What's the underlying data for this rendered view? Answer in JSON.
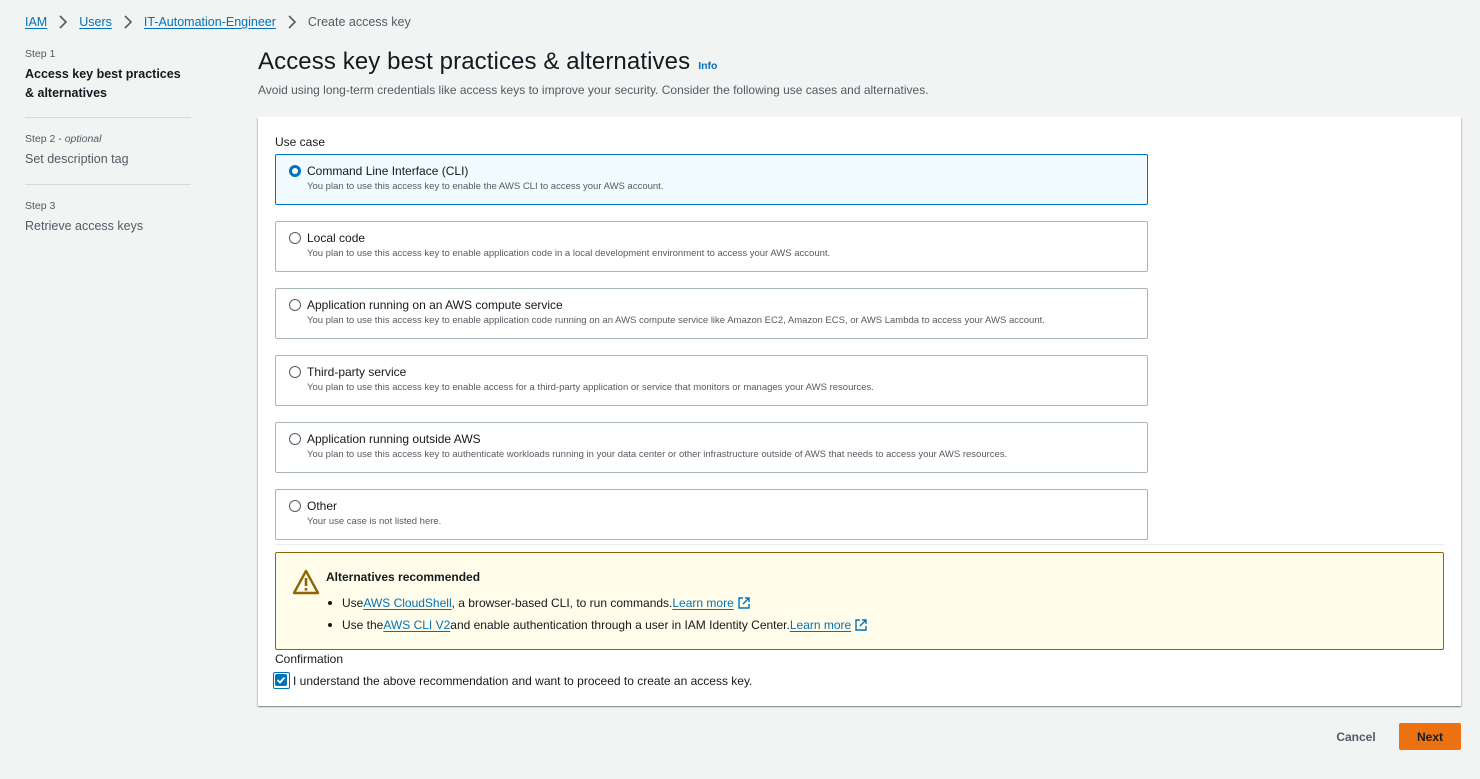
{
  "breadcrumb": {
    "items": [
      "IAM",
      "Users",
      "IT-Automation-Engineer"
    ],
    "current": "Create access key"
  },
  "steps": [
    {
      "num": "Step 1",
      "optional": "",
      "title": "Access key best practices & alternatives"
    },
    {
      "num": "Step 2 - ",
      "optional": "optional",
      "title": "Set description tag"
    },
    {
      "num": "Step 3",
      "optional": "",
      "title": "Retrieve access keys"
    }
  ],
  "header": {
    "title": "Access key best practices & alternatives",
    "info": "Info",
    "subtitle": "Avoid using long-term credentials like access keys to improve your security. Consider the following use cases and alternatives."
  },
  "use_case": {
    "label": "Use case",
    "selected": "Command Line Interface (CLI)",
    "options": [
      {
        "title": "Command Line Interface (CLI)",
        "desc": "You plan to use this access key to enable the AWS CLI to access your AWS account."
      },
      {
        "title": "Local code",
        "desc": "You plan to use this access key to enable application code in a local development environment to access your AWS account."
      },
      {
        "title": "Application running on an AWS compute service",
        "desc": "You plan to use this access key to enable application code running on an AWS compute service like Amazon EC2, Amazon ECS, or AWS Lambda to access your AWS account."
      },
      {
        "title": "Third-party service",
        "desc": "You plan to use this access key to enable access for a third-party application or service that monitors or manages your AWS resources."
      },
      {
        "title": "Application running outside AWS",
        "desc": "You plan to use this access key to authenticate workloads running in your data center or other infrastructure outside of AWS that needs to access your AWS resources."
      },
      {
        "title": "Other",
        "desc": "Your use case is not listed here."
      }
    ]
  },
  "alert": {
    "title": "Alternatives recommended",
    "icon": "warning-icon",
    "item1": {
      "pre": "Use ",
      "link": "AWS CloudShell",
      "post": ", a browser-based CLI, to run commands. ",
      "learn": "Learn more"
    },
    "item2": {
      "pre": "Use the ",
      "link": "AWS CLI V2",
      "post": " and enable authentication through a user in IAM Identity Center. ",
      "learn": "Learn more"
    }
  },
  "confirmation": {
    "label": "Confirmation",
    "text": "I understand the above recommendation and want to proceed to create an access key.",
    "checked": true
  },
  "footer": {
    "cancel": "Cancel",
    "next": "Next"
  },
  "colors": {
    "link": "#0073bb",
    "primary_button": "#ec7211",
    "alert_bg": "#fffce9",
    "alert_border": "#8d6605",
    "selected_bg": "#f1faff"
  }
}
